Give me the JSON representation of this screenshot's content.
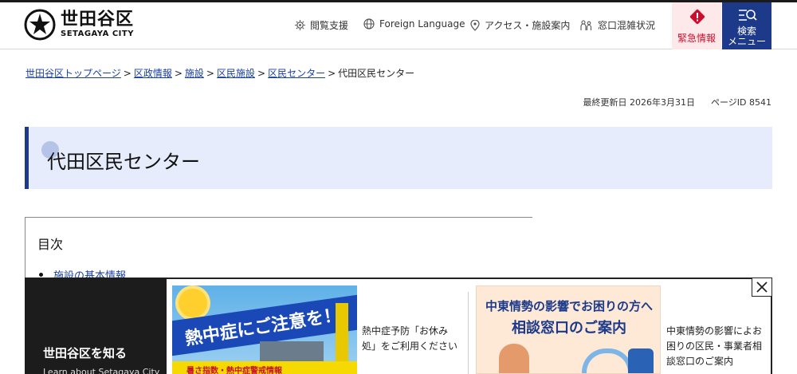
{
  "header": {
    "logo_jp": "世田谷区",
    "logo_en": "SETAGAYA CITY",
    "nav": [
      {
        "label": "閲覧支援",
        "icon": "gear-icon"
      },
      {
        "label": "Foreign Language",
        "icon": "globe-icon"
      },
      {
        "label": "アクセス・施設案内",
        "icon": "map-pin-icon"
      },
      {
        "label": "窓口混雑状況",
        "icon": "people-icon"
      }
    ],
    "emergency_label": "緊急情報",
    "search_label_1": "検索",
    "search_label_2": "メニュー"
  },
  "breadcrumb": {
    "items": [
      "世田谷区トップページ",
      "区政情報",
      "施設",
      "区民施設",
      "区民センター"
    ],
    "separator": ">",
    "current": "代田区民センター"
  },
  "meta": {
    "updated": "最終更新日 2026年3月31日",
    "page_id": "ページID 8541"
  },
  "page_title": "代田区民センター",
  "toc": {
    "title": "目次",
    "items": [
      "施設の基本情報"
    ]
  },
  "banner": {
    "heading": "世田谷区を知る",
    "sub": "Learn about Setagaya City",
    "cards": [
      {
        "image_text": "熱中症にご注意を！",
        "image_sub": "暑さ指数・熱中症警戒情報",
        "caption": "熱中症予防「お休み処」をご利用ください"
      },
      {
        "image_line1": "中東情勢の影響でお困りの方へ",
        "image_line2": "相談窓口のご案内",
        "caption": "中東情勢の影響によお困りの区民・事業者相談窓口のご案内"
      }
    ]
  },
  "colors": {
    "brand_blue": "#1d3a8a",
    "title_bg": "#e6ecfb",
    "emergency_red": "#c8102e",
    "link": "#1a3fa0"
  }
}
